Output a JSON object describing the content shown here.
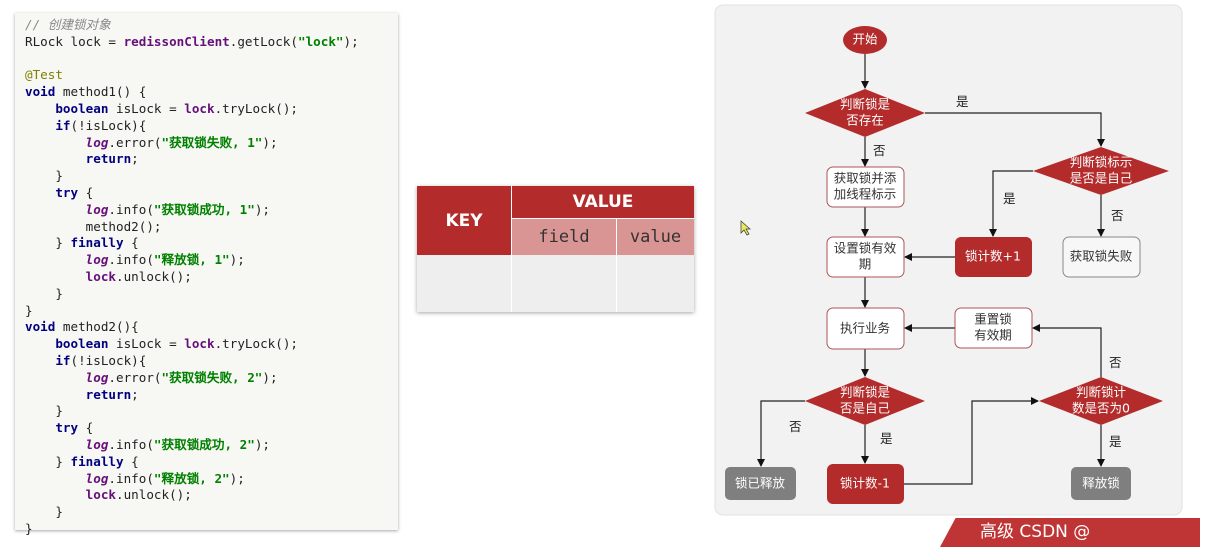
{
  "code": {
    "lines": [
      [
        [
          "comment",
          "// 创建锁对象"
        ]
      ],
      [
        [
          "plain",
          "RLock lock = "
        ],
        [
          "field",
          "redissonClient"
        ],
        [
          "plain",
          ".getLock("
        ],
        [
          "str",
          "\"lock\""
        ],
        [
          "plain",
          ");"
        ]
      ],
      [],
      [
        [
          "anno",
          "@Test"
        ]
      ],
      [
        [
          "kw",
          "void"
        ],
        [
          "plain",
          " method1() {"
        ]
      ],
      [
        [
          "plain",
          "    "
        ],
        [
          "kw",
          "boolean"
        ],
        [
          "plain",
          " isLock = "
        ],
        [
          "field",
          "lock"
        ],
        [
          "plain",
          ".tryLock();"
        ]
      ],
      [
        [
          "plain",
          "    "
        ],
        [
          "kw",
          "if"
        ],
        [
          "plain",
          "(!isLock){"
        ]
      ],
      [
        [
          "plain",
          "        "
        ],
        [
          "log",
          "log"
        ],
        [
          "plain",
          ".error("
        ],
        [
          "str",
          "\"获取锁失败, 1\""
        ],
        [
          "plain",
          ");"
        ]
      ],
      [
        [
          "plain",
          "        "
        ],
        [
          "kw",
          "return"
        ],
        [
          "plain",
          ";"
        ]
      ],
      [
        [
          "plain",
          "    }"
        ]
      ],
      [
        [
          "plain",
          "    "
        ],
        [
          "kw",
          "try"
        ],
        [
          "plain",
          " {"
        ]
      ],
      [
        [
          "plain",
          "        "
        ],
        [
          "log",
          "log"
        ],
        [
          "plain",
          ".info("
        ],
        [
          "str",
          "\"获取锁成功, 1\""
        ],
        [
          "plain",
          ");"
        ]
      ],
      [
        [
          "plain",
          "        method2();"
        ]
      ],
      [
        [
          "plain",
          "    } "
        ],
        [
          "kw",
          "finally"
        ],
        [
          "plain",
          " {"
        ]
      ],
      [
        [
          "plain",
          "        "
        ],
        [
          "log",
          "log"
        ],
        [
          "plain",
          ".info("
        ],
        [
          "str",
          "\"释放锁, 1\""
        ],
        [
          "plain",
          ");"
        ]
      ],
      [
        [
          "plain",
          "        "
        ],
        [
          "field",
          "lock"
        ],
        [
          "plain",
          ".unlock();"
        ]
      ],
      [
        [
          "plain",
          "    }"
        ]
      ],
      [
        [
          "plain",
          "}"
        ]
      ],
      [
        [
          "kw",
          "void"
        ],
        [
          "plain",
          " method2(){"
        ]
      ],
      [
        [
          "plain",
          "    "
        ],
        [
          "kw",
          "boolean"
        ],
        [
          "plain",
          " isLock = "
        ],
        [
          "field",
          "lock"
        ],
        [
          "plain",
          ".tryLock();"
        ]
      ],
      [
        [
          "plain",
          "    "
        ],
        [
          "kw",
          "if"
        ],
        [
          "plain",
          "(!isLock){"
        ]
      ],
      [
        [
          "plain",
          "        "
        ],
        [
          "log",
          "log"
        ],
        [
          "plain",
          ".error("
        ],
        [
          "str",
          "\"获取锁失败, 2\""
        ],
        [
          "plain",
          ");"
        ]
      ],
      [
        [
          "plain",
          "        "
        ],
        [
          "kw",
          "return"
        ],
        [
          "plain",
          ";"
        ]
      ],
      [
        [
          "plain",
          "    }"
        ]
      ],
      [
        [
          "plain",
          "    "
        ],
        [
          "kw",
          "try"
        ],
        [
          "plain",
          " {"
        ]
      ],
      [
        [
          "plain",
          "        "
        ],
        [
          "log",
          "log"
        ],
        [
          "plain",
          ".info("
        ],
        [
          "str",
          "\"获取锁成功, 2\""
        ],
        [
          "plain",
          ");"
        ]
      ],
      [
        [
          "plain",
          "    } "
        ],
        [
          "kw",
          "finally"
        ],
        [
          "plain",
          " {"
        ]
      ],
      [
        [
          "plain",
          "        "
        ],
        [
          "log",
          "log"
        ],
        [
          "plain",
          ".info("
        ],
        [
          "str",
          "\"释放锁, 2\""
        ],
        [
          "plain",
          ");"
        ]
      ],
      [
        [
          "plain",
          "        "
        ],
        [
          "field",
          "lock"
        ],
        [
          "plain",
          ".unlock();"
        ]
      ],
      [
        [
          "plain",
          "    }"
        ]
      ],
      [
        [
          "plain",
          "}"
        ]
      ]
    ]
  },
  "table": {
    "key_header": "KEY",
    "value_header": "VALUE",
    "sub_headers": [
      "field",
      "value"
    ]
  },
  "flow": {
    "start": "开始",
    "d_exists": [
      "判断锁是",
      "否存在"
    ],
    "acquire": [
      "获取锁并添",
      "加线程标示"
    ],
    "set_expire": [
      "设置锁有效",
      "期"
    ],
    "d_self1": [
      "判断锁标示",
      "是否是自己"
    ],
    "count_inc": "锁计数+1",
    "acquire_fail": "获取锁失败",
    "execute": "执行业务",
    "reset_expire": [
      "重置锁",
      "有效期"
    ],
    "d_self2": [
      "判断锁是",
      "否是自己"
    ],
    "d_zero": [
      "判断锁计",
      "数是否为0"
    ],
    "released": "锁已释放",
    "count_dec": "锁计数-1",
    "release": "释放锁",
    "yes": "是",
    "no": "否"
  },
  "watermark": "高级 CSDN @",
  "colors": {
    "accent_red": "#b32b2b",
    "grey_node": "#7f7f7f",
    "panel_bg": "#f2f2f2"
  }
}
